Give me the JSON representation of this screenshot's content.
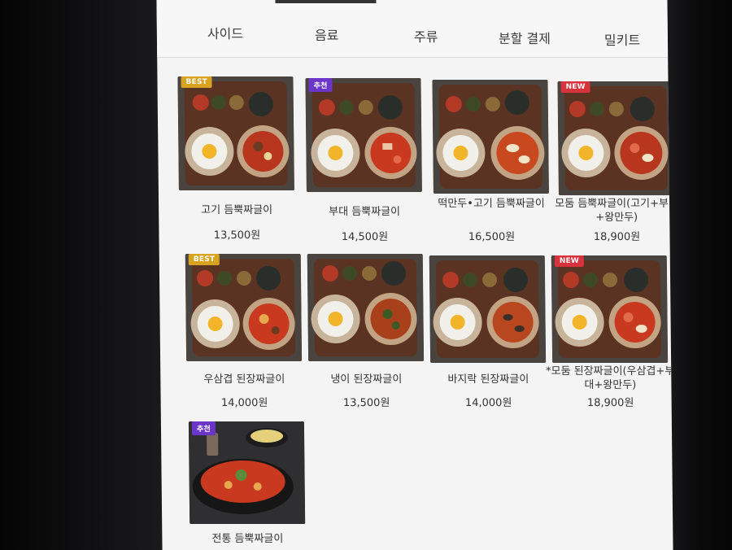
{
  "tabs": [
    {
      "label": "사이드"
    },
    {
      "label": "음료"
    },
    {
      "label": "주류"
    },
    {
      "label": "분할 결제"
    },
    {
      "label": "밀키트"
    }
  ],
  "menu": [
    {
      "name": "고기 듬뿍짜글이",
      "price": "13,500원",
      "badge": "BEST",
      "badge_type": "best"
    },
    {
      "name": "부대 듬뿍짜글이",
      "price": "14,500원",
      "badge": "추천",
      "badge_type": "rec"
    },
    {
      "name": "떡만두•고기 듬뿍짜글이",
      "price": "16,500원",
      "badge": "",
      "badge_type": ""
    },
    {
      "name": "모둠 듬뿍짜글이(고기+부대+왕만두)",
      "price": "18,900원",
      "badge": "NEW",
      "badge_type": "new"
    },
    {
      "name": "우삼겹 된장짜글이",
      "price": "14,000원",
      "badge": "BEST",
      "badge_type": "best"
    },
    {
      "name": "냉이 된장짜글이",
      "price": "13,500원",
      "badge": "",
      "badge_type": ""
    },
    {
      "name": "바지락 된장짜글이",
      "price": "14,000원",
      "badge": "",
      "badge_type": ""
    },
    {
      "name": "*모둠 된장짜글이(우삼겹+부대+왕만두)",
      "price": "18,900원",
      "badge": "NEW",
      "badge_type": "new"
    },
    {
      "name": "전통 듬뿍짜글이",
      "price": "",
      "badge": "추천",
      "badge_type": "rec"
    }
  ],
  "colors": {
    "best": "#d9a322",
    "recommend": "#6b35c9",
    "new": "#d8333c"
  }
}
